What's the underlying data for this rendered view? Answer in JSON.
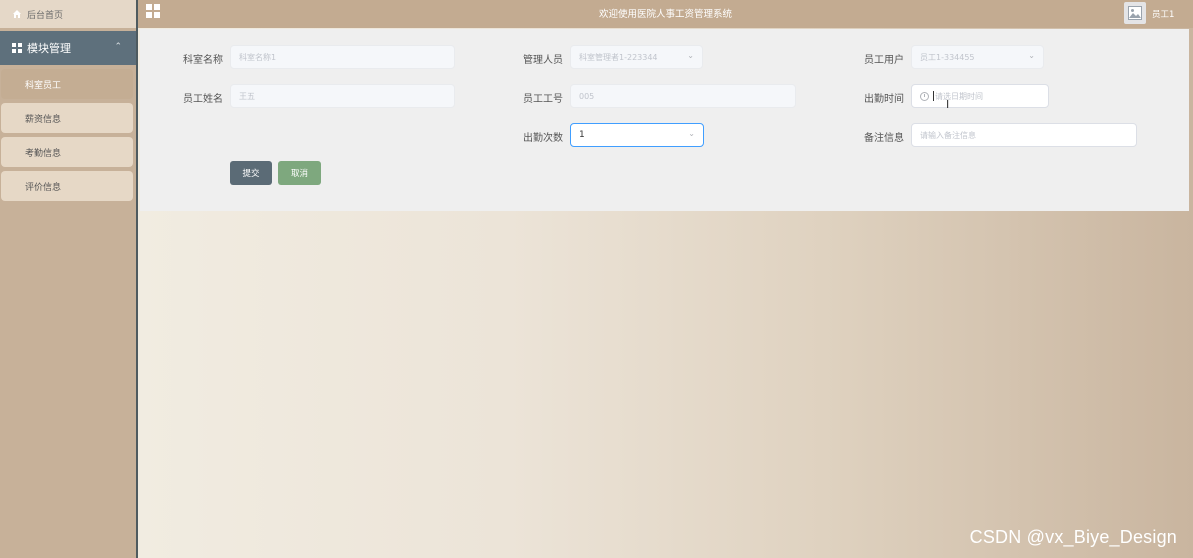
{
  "header": {
    "title": "欢迎使用医院人事工资管理系统",
    "user_name": "员工1"
  },
  "sidebar": {
    "home_label": "后台首页",
    "module_label": "模块管理",
    "items": [
      {
        "label": "科室员工",
        "active": true
      },
      {
        "label": "薪资信息",
        "active": false
      },
      {
        "label": "考勤信息",
        "active": false
      },
      {
        "label": "评价信息",
        "active": false
      }
    ]
  },
  "form": {
    "department_name": {
      "label": "科室名称",
      "value": "科室名称1"
    },
    "manager": {
      "label": "管理人员",
      "value": "科室管理者1-223344"
    },
    "employee_user": {
      "label": "员工用户",
      "value": "员工1-334455"
    },
    "employee_name": {
      "label": "员工姓名",
      "value": "王五"
    },
    "employee_no": {
      "label": "员工工号",
      "value": "005"
    },
    "attendance_time": {
      "label": "出勤时间",
      "placeholder": "请选日期时间"
    },
    "attendance_count": {
      "label": "出勤次数",
      "value": "1"
    },
    "remark": {
      "label": "备注信息",
      "placeholder": "请输入备注信息"
    },
    "submit_label": "提交",
    "cancel_label": "取消"
  },
  "watermark": "CSDN @vx_Biye_Design",
  "colors": {
    "sidebar_bg": "#c7b199",
    "module_header": "#5e707c",
    "submit_button": "#5b6b76",
    "cancel_button": "#7ea87e",
    "focus_border": "#409eff"
  }
}
